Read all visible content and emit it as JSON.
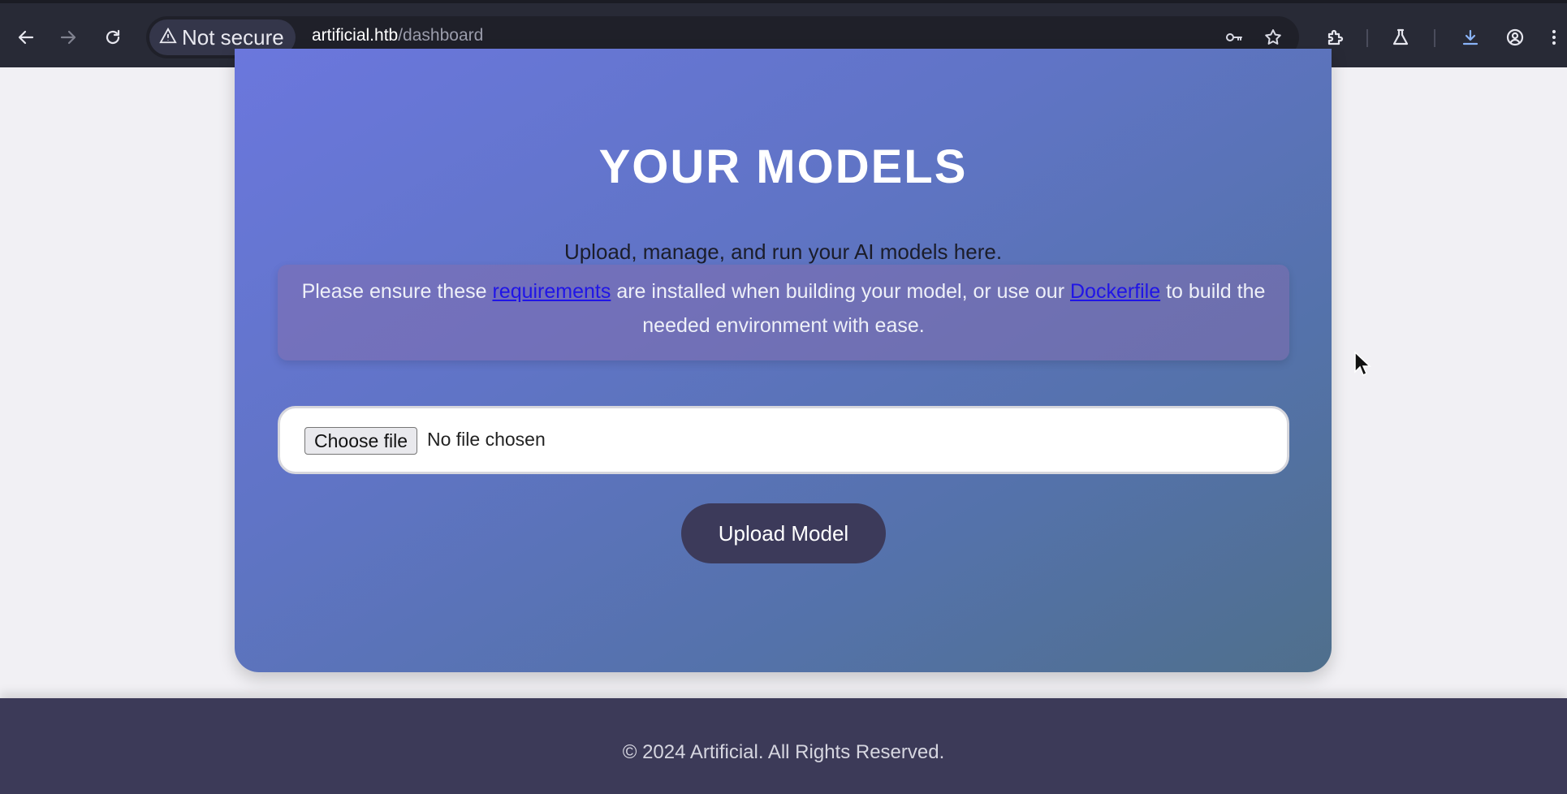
{
  "browser": {
    "security_label": "Not secure",
    "url_host": "artificial.htb",
    "url_path": "/dashboard",
    "icons": [
      "back-icon",
      "forward-icon",
      "reload-icon",
      "warning-icon",
      "key-icon",
      "star-icon",
      "extensions-icon",
      "labs-icon",
      "download-icon",
      "profile-icon",
      "menu-icon"
    ]
  },
  "page": {
    "title": "YOUR MODELS",
    "subtitle": "Upload, manage, and run your AI models here.",
    "notice": {
      "prefix": "Please ensure these ",
      "link1": "requirements",
      "middle": " are installed when building your model, or use our ",
      "link2": "Dockerfile",
      "suffix": " to build the needed environment with ease."
    },
    "file_input": {
      "button_label": "Choose file",
      "status": "No file chosen"
    },
    "upload_button": "Upload Model",
    "footer": "© 2024 Artificial. All Rights Reserved."
  },
  "colors": {
    "card_gradient_start": "#6b77dd",
    "card_gradient_end": "#4f6f8c",
    "link": "#2015e6",
    "button": "#3c3a5a",
    "footer": "#3c3a58"
  }
}
